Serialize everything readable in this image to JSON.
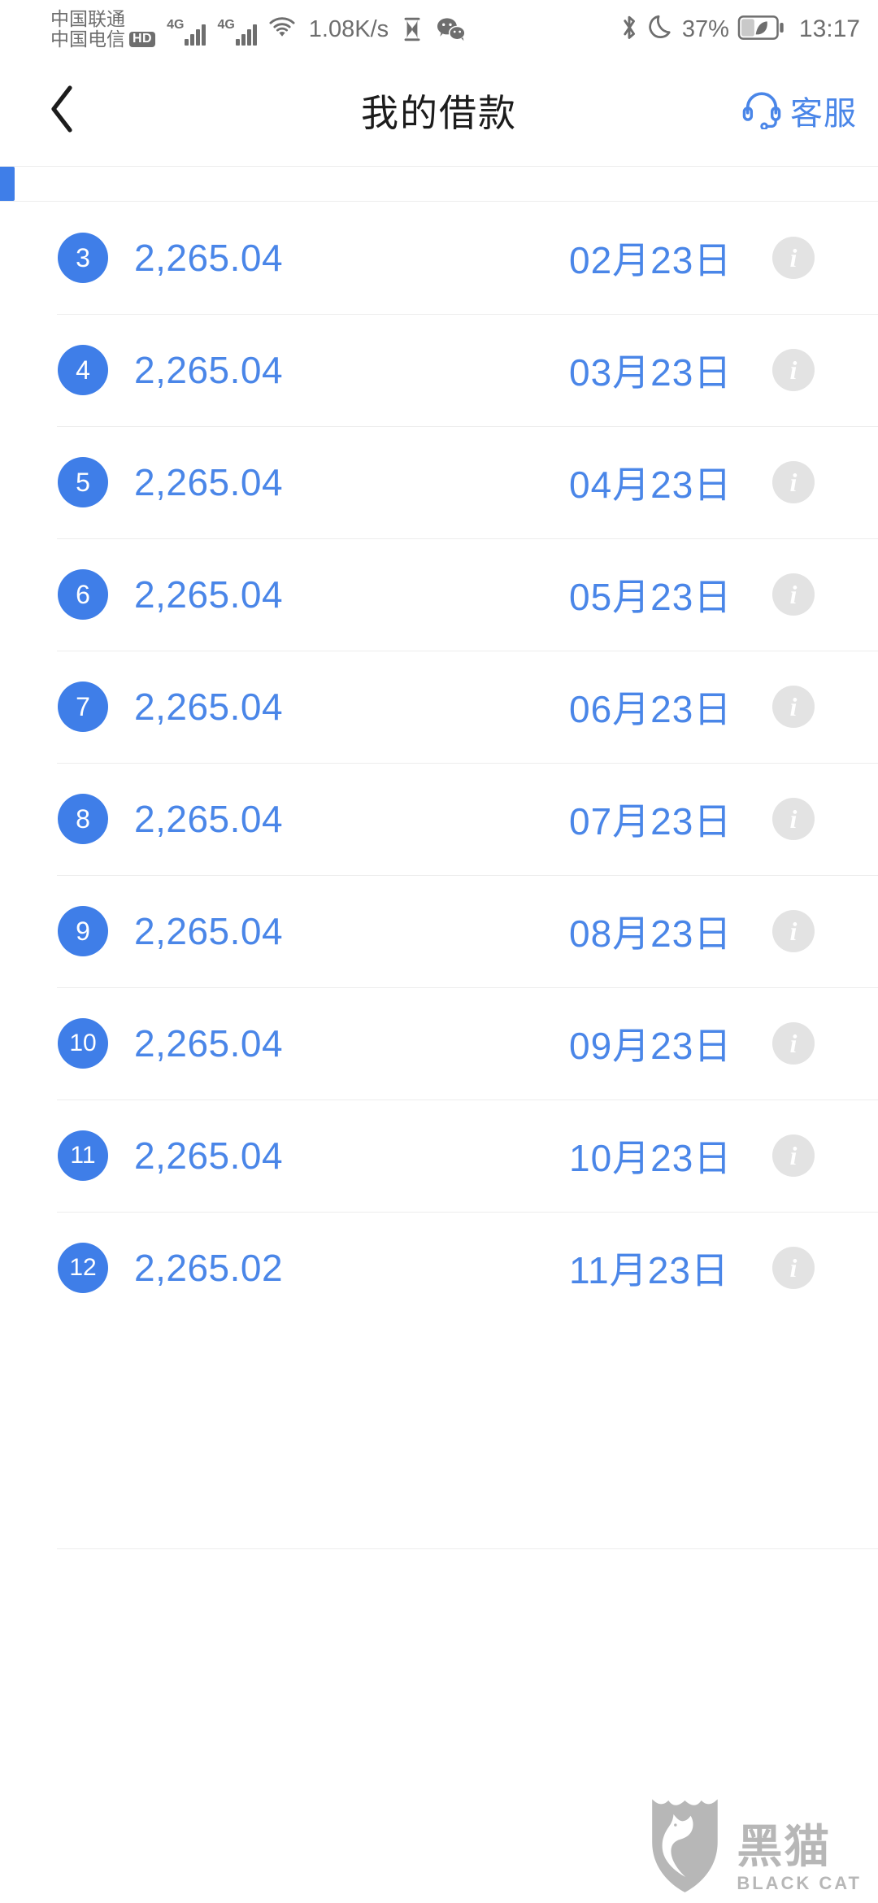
{
  "statusbar": {
    "carrier_primary": "中国联通",
    "carrier_secondary": "中国电信",
    "hd_badge": "HD",
    "network_type_1": "4G",
    "network_type_2": "4G",
    "net_speed": "1.08K/s",
    "icons": [
      "hourglass-icon",
      "wechat-icon",
      "bluetooth-icon",
      "do-not-disturb-moon-icon",
      "wifi-icon"
    ],
    "battery_percent": "37%",
    "battery_saver": "leaf-icon",
    "time": "13:17"
  },
  "header": {
    "back_icon": "chevron-left-icon",
    "title": "我的借款",
    "service_icon": "headset-icon",
    "service_label": "客服"
  },
  "list": {
    "info_icon_glyph": "i",
    "rows": [
      {
        "index": "3",
        "amount": "2,265.04",
        "date": "02月23日"
      },
      {
        "index": "4",
        "amount": "2,265.04",
        "date": "03月23日"
      },
      {
        "index": "5",
        "amount": "2,265.04",
        "date": "04月23日"
      },
      {
        "index": "6",
        "amount": "2,265.04",
        "date": "05月23日"
      },
      {
        "index": "7",
        "amount": "2,265.04",
        "date": "06月23日"
      },
      {
        "index": "8",
        "amount": "2,265.04",
        "date": "07月23日"
      },
      {
        "index": "9",
        "amount": "2,265.04",
        "date": "08月23日"
      },
      {
        "index": "10",
        "amount": "2,265.04",
        "date": "09月23日"
      },
      {
        "index": "11",
        "amount": "2,265.04",
        "date": "10月23日"
      },
      {
        "index": "12",
        "amount": "2,265.02",
        "date": "11月23日"
      }
    ]
  },
  "watermark": {
    "logo_icon": "black-cat-shield-icon",
    "cn": "黑猫",
    "en": "BLACK CAT"
  },
  "colors": {
    "accent_blue": "#4a86e8",
    "badge_blue": "#3f7ee8",
    "divider": "#ededed",
    "info_gray": "#e3e3e3",
    "status_gray": "#6e6e6e"
  }
}
